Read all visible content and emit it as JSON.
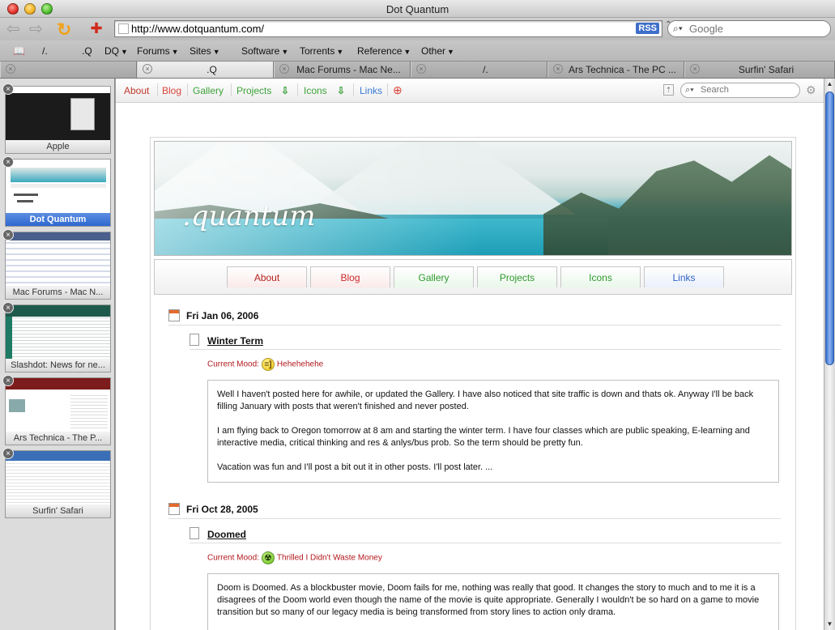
{
  "window": {
    "title": "Dot Quantum"
  },
  "toolbar": {
    "address": "http://www.dotquantum.com/",
    "rss_label": "RSS",
    "search_placeholder": "Google"
  },
  "bookmarks": [
    {
      "label": "/."
    },
    {
      "label": ".Q"
    },
    {
      "label": "DQ",
      "menu": true
    },
    {
      "label": "Forums",
      "menu": true
    },
    {
      "label": "Sites",
      "menu": true
    },
    {
      "label": "Software",
      "menu": true
    },
    {
      "label": "Torrents",
      "menu": true
    },
    {
      "label": "Reference",
      "menu": true
    },
    {
      "label": "Other",
      "menu": true
    }
  ],
  "tabs": [
    {
      "label": ""
    },
    {
      "label": ".Q",
      "active": true
    },
    {
      "label": "Mac Forums - Mac Ne..."
    },
    {
      "label": "/."
    },
    {
      "label": "Ars Technica - The PC ..."
    },
    {
      "label": "Surfin' Safari"
    }
  ],
  "drawer": [
    {
      "caption": "Apple"
    },
    {
      "caption": "Dot Quantum",
      "active": true
    },
    {
      "caption": "Mac Forums - Mac N..."
    },
    {
      "caption": "Slashdot: News for ne..."
    },
    {
      "caption": "Ars Technica - The P..."
    },
    {
      "caption": "Surfin' Safari"
    }
  ],
  "sitebar": {
    "links": [
      {
        "label": "About",
        "color": "#c0392b"
      },
      {
        "label": "Blog",
        "color": "#d9443a"
      },
      {
        "label": "Gallery",
        "color": "#3da33a"
      },
      {
        "label": "Projects",
        "color": "#3da33a"
      },
      {
        "label": "Icons",
        "color": "#3da33a"
      },
      {
        "label": "Links",
        "color": "#3a7bd5"
      }
    ],
    "search_placeholder": "Search"
  },
  "site": {
    "logo": ".quantum",
    "nav": [
      {
        "label": "About",
        "color": "#b3231d"
      },
      {
        "label": "Blog",
        "color": "#cc2a2a"
      },
      {
        "label": "Gallery",
        "color": "#2f9a2f"
      },
      {
        "label": "Projects",
        "color": "#2f9a2f"
      },
      {
        "label": "Icons",
        "color": "#2f9a2f"
      },
      {
        "label": "Links",
        "color": "#2f62c4"
      }
    ]
  },
  "posts": [
    {
      "date": "Fri Jan 06, 2006",
      "title": "Winter Term",
      "mood_label": "Current Mood:",
      "mood": "Hehehehehe",
      "mood_face": "=]",
      "paragraphs": [
        "Well I haven't posted here for awhile, or updated the Gallery. I have also noticed that site traffic is down and thats ok. Anyway I'll be back filling January with posts that weren't finished and never posted.",
        "I am flying back to Oregon tomorrow at 8 am and starting the winter term. I have four classes which are public speaking, E-learning and interactive media, critical thinking and res & anlys/bus prob. So the term should be pretty fun.",
        "Vacation was fun and I'll post a bit out it in other posts. I'll post later. ..."
      ]
    },
    {
      "date": "Fri Oct 28, 2005",
      "title": "Doomed",
      "mood_label": "Current Mood:",
      "mood": "Thrilled I Didn't Waste Money",
      "mood_face": "☢",
      "paragraphs": [
        "Doom is Doomed. As a blockbuster movie, Doom fails for me, nothing was really that good. It changes the story to much and to me it is a disagrees of the Doom world even though the name of the movie is quite appropriate. Generally I wouldn't be so hard on a game to movie transition but so many of our legacy media is being transformed from story lines to action only drama."
      ]
    }
  ]
}
